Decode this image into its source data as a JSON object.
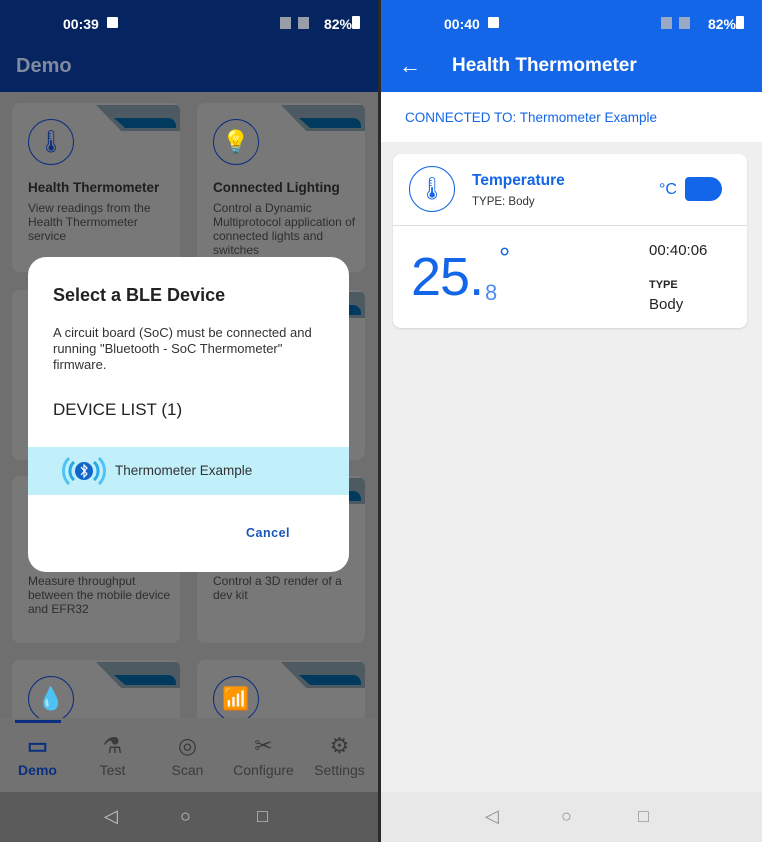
{
  "left": {
    "status": {
      "time": "00:39",
      "battery": "82%"
    },
    "appbar_title": "Demo",
    "cards": [
      {
        "title": "Health Thermometer",
        "desc": "View readings from the Health Thermometer service",
        "icon": "thermometer-icon"
      },
      {
        "title": "Connected Lighting",
        "desc": "Control a Dynamic Multiprotocol application of connected lights and switches",
        "icon": "lightbulb-icon"
      },
      {
        "title": "",
        "desc": "Measure throughput between the mobile device and EFR32",
        "icon": ""
      },
      {
        "title": "",
        "desc": "Control a 3D render of a dev kit",
        "icon": ""
      },
      {
        "title": "",
        "desc": "",
        "icon": "water-drop-icon"
      },
      {
        "title": "",
        "desc": "",
        "icon": "wifi-router-icon"
      }
    ],
    "dialog": {
      "title": "Select a BLE Device",
      "message": "A circuit board (SoC) must be connected and running \"Bluetooth - SoC Thermometer\" firmware.",
      "device_list_label": "DEVICE LIST (1)",
      "devices": [
        {
          "name": "Thermometer Example"
        }
      ],
      "cancel_label": "Cancel"
    },
    "bottom_nav": [
      {
        "label": "Demo",
        "active": true
      },
      {
        "label": "Test"
      },
      {
        "label": "Scan"
      },
      {
        "label": "Configure"
      },
      {
        "label": "Settings"
      }
    ]
  },
  "right": {
    "status": {
      "time": "00:40",
      "battery": "82%"
    },
    "appbar_title": "Health Thermometer",
    "connected_text": "CONNECTED TO: Thermometer Example",
    "card": {
      "title": "Temperature",
      "type_line": "TYPE: Body",
      "unit": "°C",
      "value_int": "25.",
      "value_dec": "8",
      "degree": "°",
      "timestamp": "00:40:06",
      "type_label": "TYPE",
      "type_value": "Body"
    }
  },
  "colors": {
    "accent": "#1466e8",
    "dim_header": "#06245f",
    "selected_row": "#c1f0fb"
  }
}
